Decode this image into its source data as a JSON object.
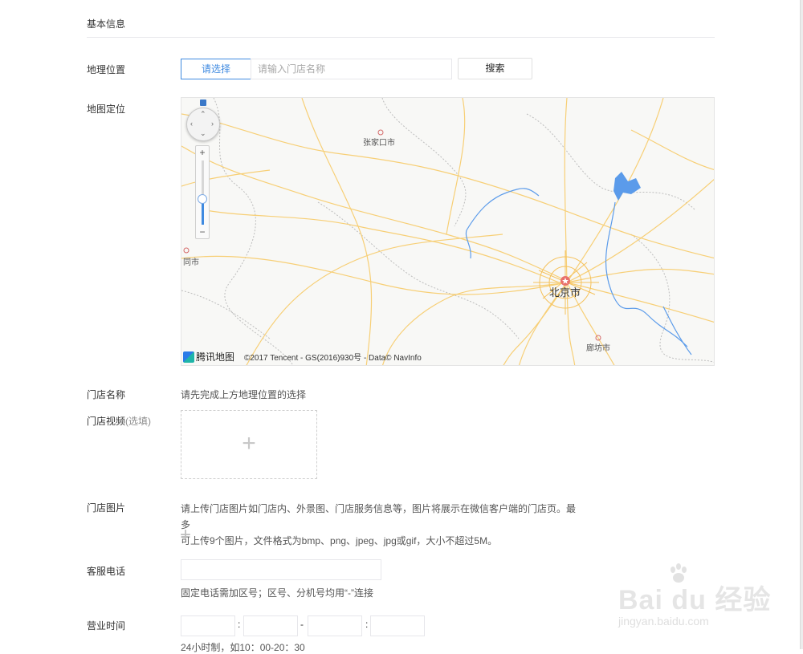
{
  "section": {
    "title": "基本信息"
  },
  "location": {
    "label": "地理位置",
    "select_button": "请选择",
    "store_name_placeholder": "请输入门店名称",
    "search_button": "搜索"
  },
  "map": {
    "label": "地图定位",
    "cities": [
      "张家口市",
      "同市",
      "北京市",
      "廊坊市"
    ],
    "logo_text": "腾讯地图",
    "copyright": "©2017 Tencent - GS(2016)930号 - Data© NavInfo",
    "zoom_level": 0.4,
    "colors": {
      "road": "#f7cf76",
      "water": "#5b9bea",
      "background": "#f8f8f6",
      "border": "#bdbdbd",
      "marker": "#e8706b"
    }
  },
  "store_name": {
    "label": "门店名称",
    "hint": "请先完成上方地理位置的选择"
  },
  "store_video": {
    "label": "门店视频",
    "label_suffix": "(选填)",
    "add_symbol": "+"
  },
  "store_photos": {
    "label": "门店图片",
    "desc_line1": "请上传门店图片如门店内、外景图、门店服务信息等，图片将展示在微信客户端的门店页。最多",
    "desc_line2": "可上传9个图片，文件格式为bmp、png、jpeg、jpg或gif，大小不超过5M。",
    "add_symbol": "+"
  },
  "phone": {
    "label": "客服电话",
    "hint": "固定电话需加区号；区号、分机号均用“-”连接"
  },
  "hours": {
    "label": "营业时间",
    "colon": ":",
    "dash": "-",
    "hint": "24小时制，如10：00-20：30"
  },
  "watermark": {
    "main": "Bai du 经验",
    "sub": "jingyan.baidu.com"
  }
}
